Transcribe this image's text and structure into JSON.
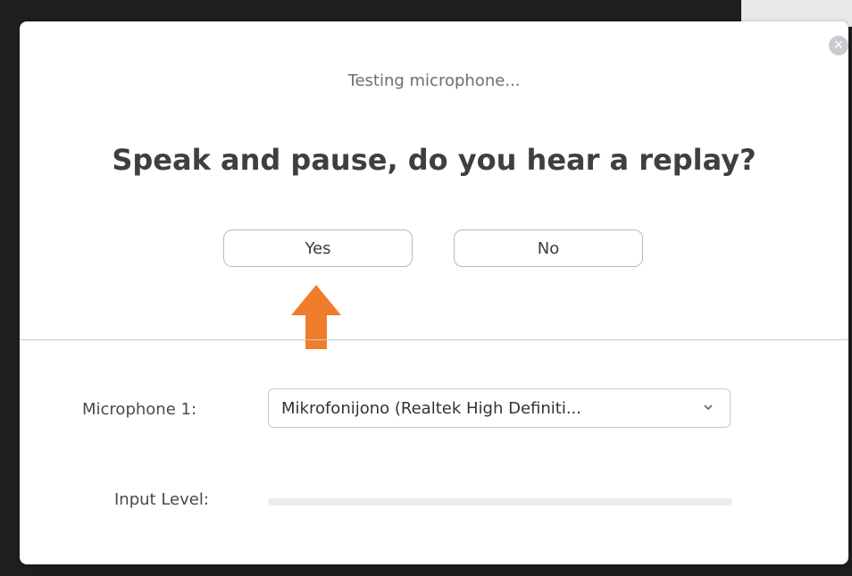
{
  "dialog": {
    "subtitle": "Testing microphone...",
    "headline": "Speak and pause, do you hear a replay?",
    "close_icon": "close-icon",
    "buttons": {
      "yes_label": "Yes",
      "no_label": "No"
    },
    "annotation_arrow": "up-arrow-icon",
    "annotation_color": "#f07d2c",
    "microphone": {
      "label": "Microphone 1:",
      "selected": "Mikrofonijono (Realtek High Definiti..."
    },
    "input_level": {
      "label": "Input Level:",
      "level_fraction": 0
    }
  }
}
